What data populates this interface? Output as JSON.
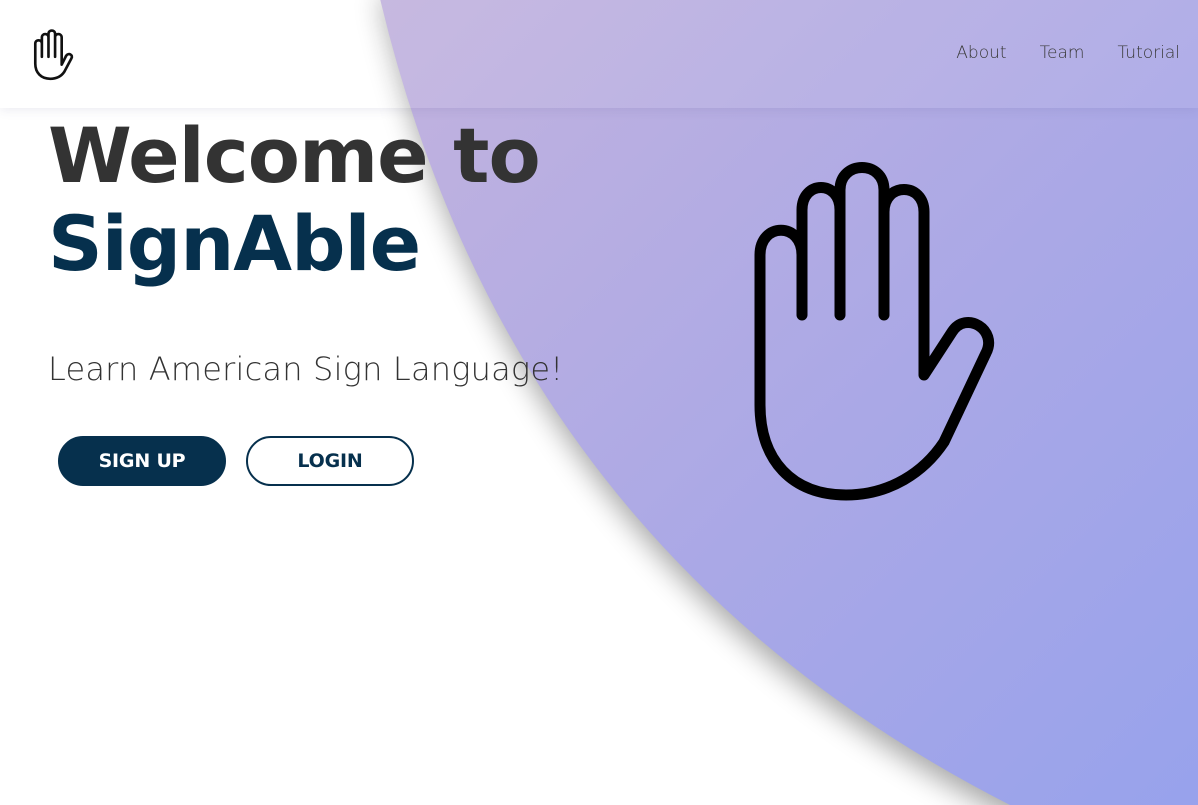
{
  "nav": {
    "logo_icon": "raised-hand-icon",
    "links": [
      "About",
      "Team",
      "Tutorial"
    ]
  },
  "hero": {
    "title_line1": "Welcome to",
    "title_line2": "SignAble",
    "subtitle": "Learn American Sign Language!",
    "signup_label": "SIGN UP",
    "login_label": "LOGIN",
    "illustration_icon": "raised-hand-icon"
  },
  "colors": {
    "primary": "#06304d",
    "heading": "#333333",
    "gradient_start": "#c3b3de",
    "gradient_end": "#9aa3ea"
  }
}
